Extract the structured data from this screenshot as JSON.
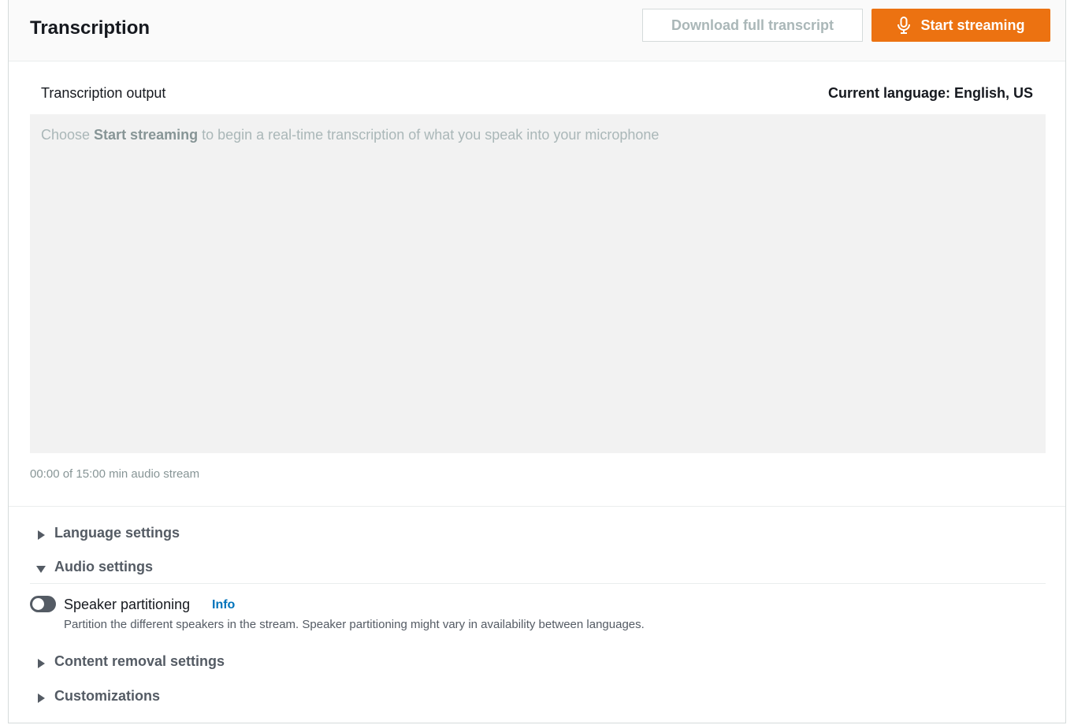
{
  "header": {
    "title": "Transcription",
    "download_label": "Download full transcript",
    "start_label": "Start streaming",
    "start_icon": "microphone-icon",
    "accent_color": "#ec7211"
  },
  "output": {
    "label": "Transcription output",
    "current_language": "Current language: English, US",
    "placeholder_prefix": "Choose ",
    "placeholder_bold": "Start streaming",
    "placeholder_suffix": " to begin a real-time transcription of what you speak into your microphone",
    "stream_info": "00:00 of 15:00 min audio stream"
  },
  "settings": {
    "language": {
      "label": "Language settings",
      "expanded": false
    },
    "audio": {
      "label": "Audio settings",
      "expanded": true
    },
    "speaker_partitioning": {
      "label": "Speaker partitioning",
      "info": "Info",
      "description": "Partition the different speakers in the stream. Speaker partitioning might vary in availability between languages.",
      "enabled": false
    },
    "content_removal": {
      "label": "Content removal settings",
      "expanded": false
    },
    "customizations": {
      "label": "Customizations",
      "expanded": false
    }
  }
}
